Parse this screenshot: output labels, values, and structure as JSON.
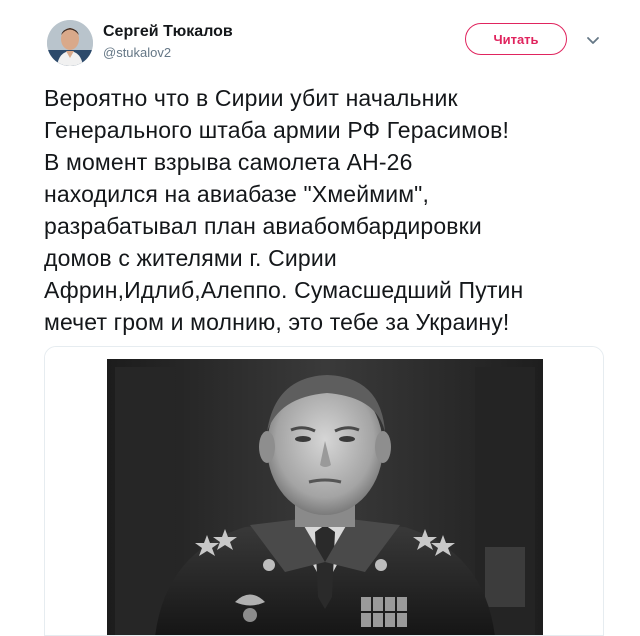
{
  "author": {
    "display_name": "Сергей Тюкалов",
    "handle": "@stukalov2"
  },
  "follow_button": {
    "label": "Читать"
  },
  "tweet": {
    "text": "Вероятно что в Сирии убит начальник\nГенерального штаба армии РФ Герасимов!\nВ момент взрыва самолета АН-26\nнаходился на авиабазе \"Хмеймим\",\nразрабатывал план авиабомбардировки\nдомов с жителями г. Сирии\nАфрин,Идлиб,Алеппо. Сумасшедший Путин\nмечет гром и молнию, это тебе за Украину!"
  },
  "icons": {
    "menu": "chevron-down-icon",
    "avatar": "profile-photo"
  },
  "colors": {
    "follow_accent": "#e0245e",
    "handle_gray": "#657786",
    "text": "#14171a"
  }
}
